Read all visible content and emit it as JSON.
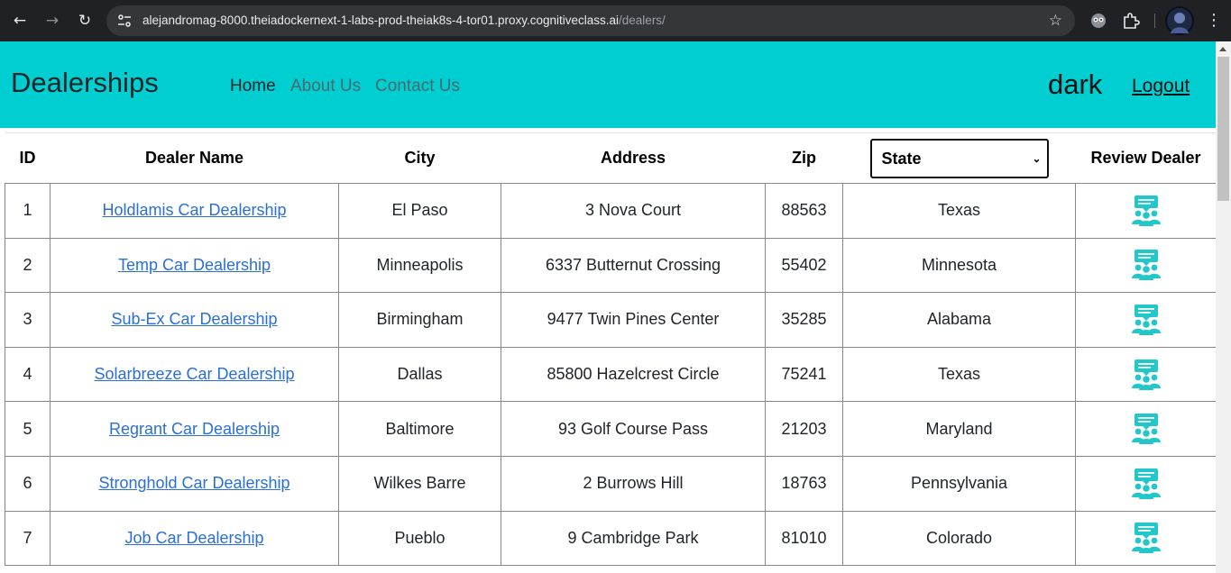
{
  "browser": {
    "url_host": "alejandromag-8000.theiadockernext-1-labs-prod-theiak8s-4-tor01.proxy.cognitiveclass.ai",
    "url_path": "/dealers/"
  },
  "header": {
    "brand": "Dealerships",
    "nav": {
      "home": "Home",
      "about": "About Us",
      "contact": "Contact Us"
    },
    "username": "dark",
    "logout": "Logout",
    "background_color": "#00ced1"
  },
  "table": {
    "columns": {
      "id": "ID",
      "dealer_name": "Dealer Name",
      "city": "City",
      "address": "Address",
      "zip": "Zip",
      "review": "Review Dealer"
    },
    "state_filter": {
      "selected": "State"
    },
    "rows": [
      {
        "id": "1",
        "name": "Holdlamis Car Dealership",
        "city": "El Paso",
        "address": "3 Nova Court",
        "zip": "88563",
        "state": "Texas"
      },
      {
        "id": "2",
        "name": "Temp Car Dealership",
        "city": "Minneapolis",
        "address": "6337 Butternut Crossing",
        "zip": "55402",
        "state": "Minnesota"
      },
      {
        "id": "3",
        "name": "Sub-Ex Car Dealership",
        "city": "Birmingham",
        "address": "9477 Twin Pines Center",
        "zip": "35285",
        "state": "Alabama"
      },
      {
        "id": "4",
        "name": "Solarbreeze Car Dealership",
        "city": "Dallas",
        "address": "85800 Hazelcrest Circle",
        "zip": "75241",
        "state": "Texas"
      },
      {
        "id": "5",
        "name": "Regrant Car Dealership",
        "city": "Baltimore",
        "address": "93 Golf Course Pass",
        "zip": "21203",
        "state": "Maryland"
      },
      {
        "id": "6",
        "name": "Stronghold Car Dealership",
        "city": "Wilkes Barre",
        "address": "2 Burrows Hill",
        "zip": "18763",
        "state": "Pennsylvania"
      },
      {
        "id": "7",
        "name": "Job Car Dealership",
        "city": "Pueblo",
        "address": "9 Cambridge Park",
        "zip": "81010",
        "state": "Colorado"
      }
    ],
    "review_icon": "review-people-chat-icon",
    "review_icon_color": "#22c7c9"
  }
}
